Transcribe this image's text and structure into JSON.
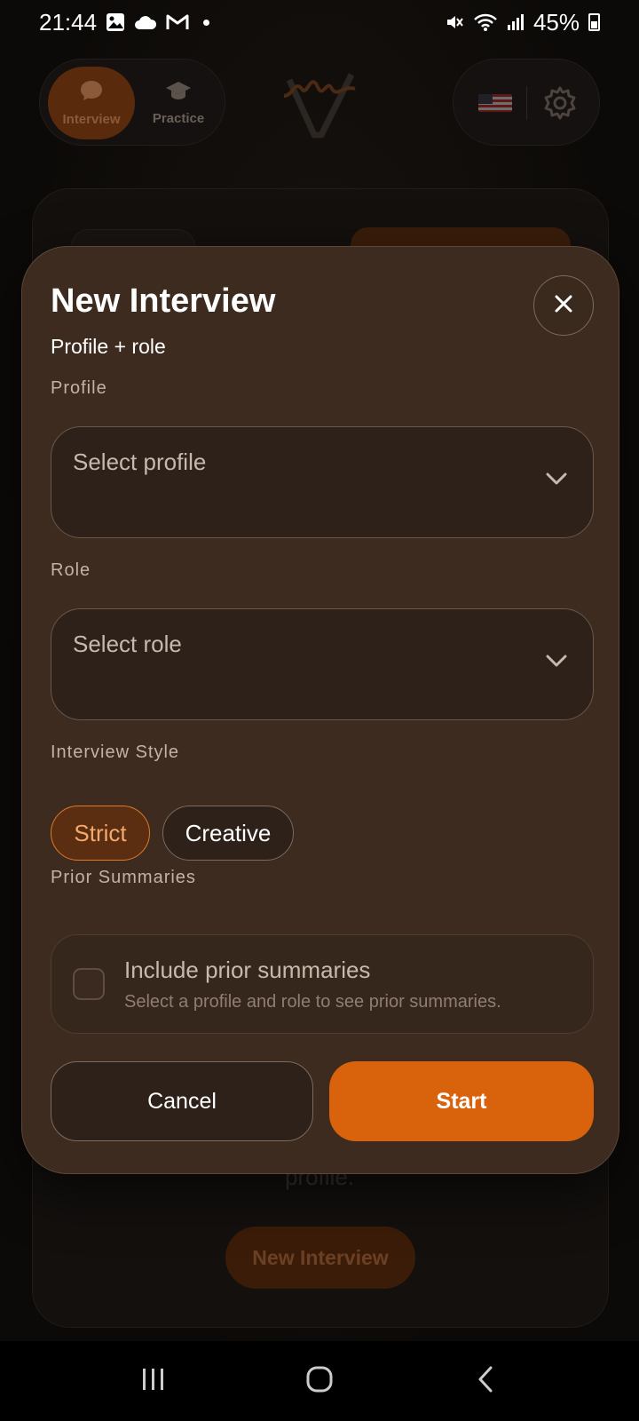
{
  "status_bar": {
    "time": "21:44",
    "battery": "45%",
    "icons": [
      "image-icon",
      "cloud-icon",
      "gmail-icon",
      "dot-icon",
      "mute-icon",
      "wifi-icon",
      "signal-icon",
      "battery-icon"
    ]
  },
  "background": {
    "tabs": [
      {
        "label": "Interview",
        "icon": "chat-bubble-icon",
        "selected": true
      },
      {
        "label": "Practice",
        "icon": "graduation-cap-icon",
        "selected": false
      }
    ],
    "partial_text": "profile.",
    "new_interview_button": "New Interview"
  },
  "modal": {
    "title": "New Interview",
    "subtitle": "Profile + role",
    "profile_label": "Profile",
    "profile_placeholder": "Select profile",
    "role_label": "Role",
    "role_placeholder": "Select role",
    "style_label": "Interview Style",
    "styles": [
      {
        "label": "Strict",
        "selected": true
      },
      {
        "label": "Creative",
        "selected": false
      }
    ],
    "prior_label": "Prior Summaries",
    "prior_checkbox_label": "Include prior summaries",
    "prior_checkbox_hint": "Select a profile and role to see prior summaries.",
    "prior_checked": false,
    "cancel_label": "Cancel",
    "start_label": "Start"
  },
  "colors": {
    "accent": "#d9620c",
    "modal_bg": "#3c2b1e",
    "chip_selected_border": "#e07a2a"
  }
}
